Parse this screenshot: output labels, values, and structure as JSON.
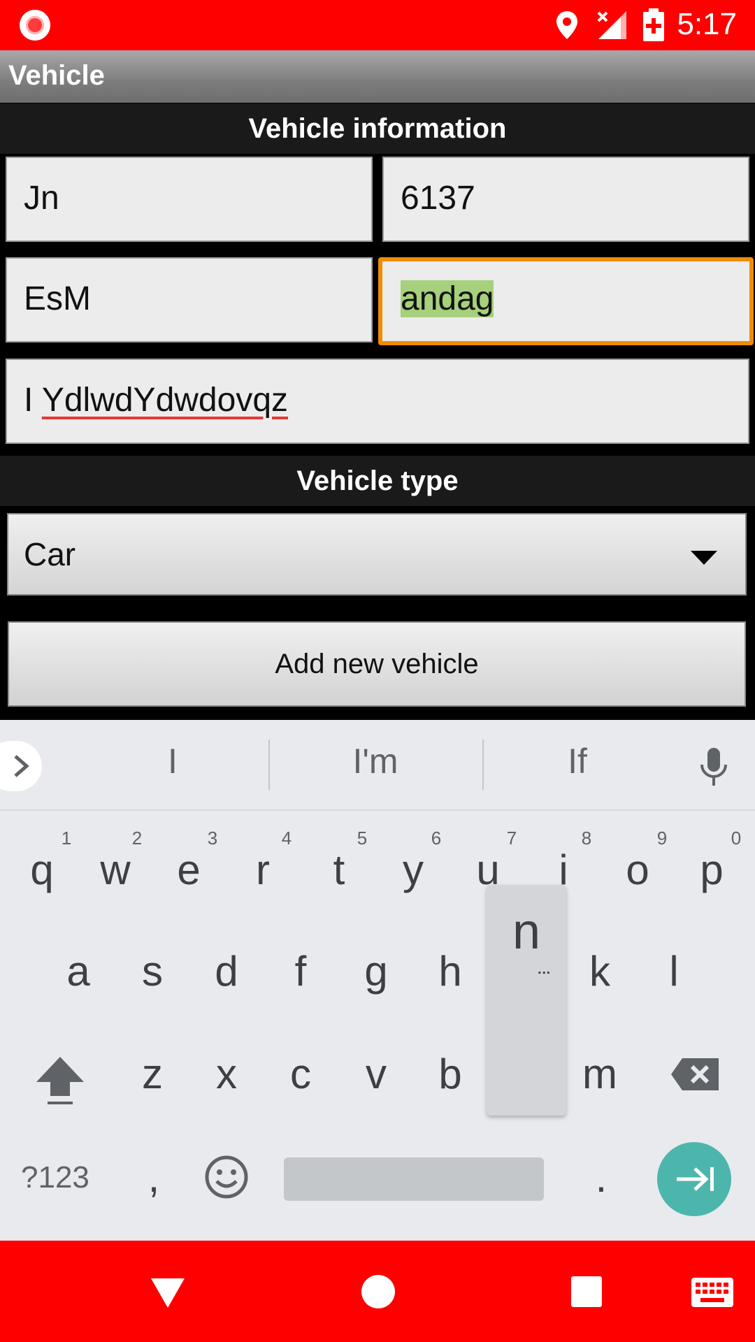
{
  "status_bar": {
    "time": "5:17"
  },
  "app_bar": {
    "title": "Vehicle"
  },
  "sections": {
    "info_header": "Vehicle information",
    "type_header": "Vehicle type"
  },
  "fields": {
    "field1": "Jn",
    "field2": "6137",
    "field3": "EsM",
    "field4": "andag",
    "field5_prefix": "I ",
    "field5_underlined": "YdlwdYdwdovqz"
  },
  "vehicle_type": {
    "selected": "Car"
  },
  "actions": {
    "add_label": "Add new vehicle"
  },
  "keyboard": {
    "suggestions": [
      "I",
      "I'm",
      "If"
    ],
    "row1": [
      "q",
      "w",
      "e",
      "r",
      "t",
      "y",
      "u",
      "i",
      "o",
      "p"
    ],
    "row1_hints": [
      "1",
      "2",
      "3",
      "4",
      "5",
      "6",
      "7",
      "8",
      "9",
      "0"
    ],
    "row2": [
      "a",
      "s",
      "d",
      "f",
      "g",
      "h",
      "k",
      "l"
    ],
    "row3": [
      "z",
      "x",
      "c",
      "v",
      "b",
      "m"
    ],
    "popup_key": "n",
    "popup_more": "…",
    "symbols_label": "?123",
    "comma": ",",
    "period": "."
  },
  "colors": {
    "status_bar": "#ff0000",
    "focus_border": "#f08c00",
    "selection": "#a6d07c",
    "enter_key": "#4db6ac"
  }
}
